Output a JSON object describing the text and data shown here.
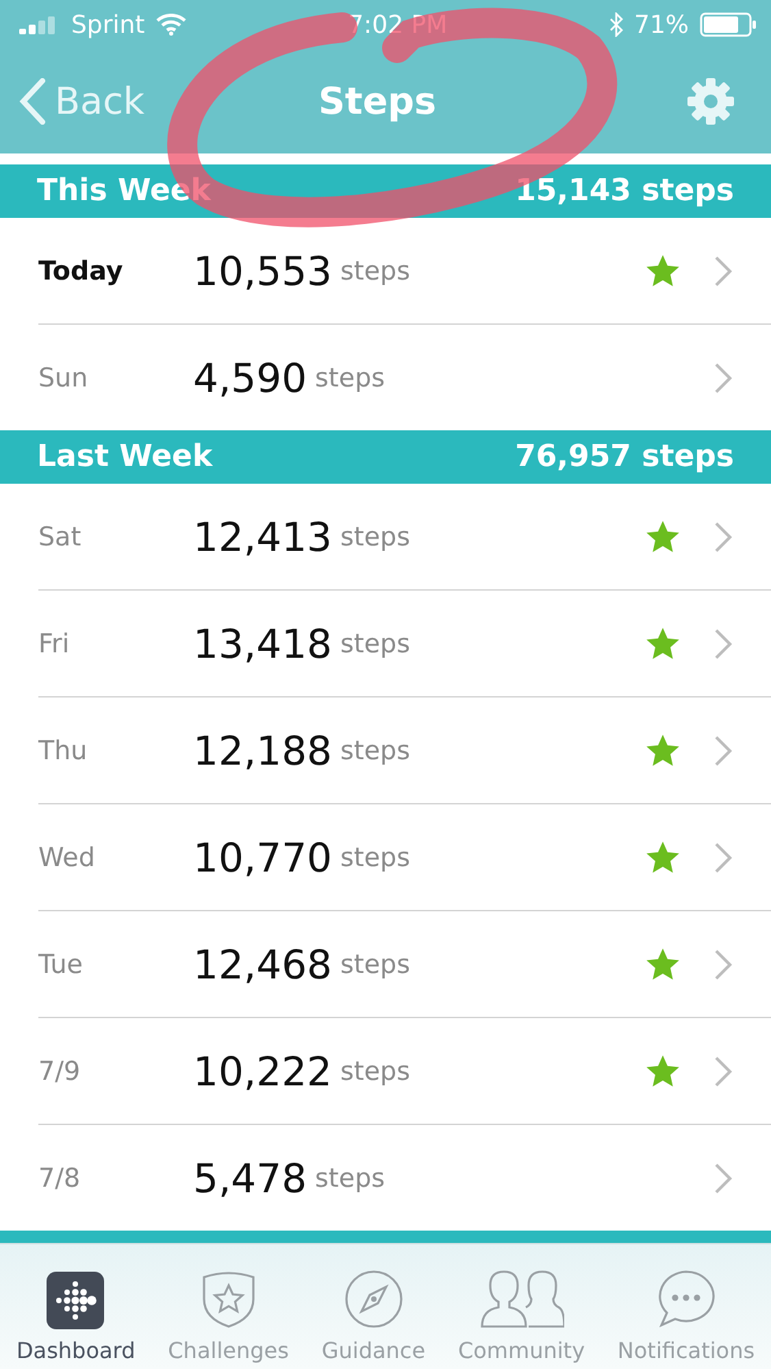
{
  "status_bar": {
    "carrier": "Sprint",
    "time": "7:02 PM",
    "battery": "71%"
  },
  "nav": {
    "back": "Back",
    "title": "Steps"
  },
  "sections": [
    {
      "label": "This Week",
      "total": "15,143 steps",
      "days": [
        {
          "day": "Today",
          "kind": "today",
          "count": "10,553",
          "unit": "steps",
          "goal_met": true
        },
        {
          "day": "Sun",
          "kind": "day",
          "count": "4,590",
          "unit": "steps",
          "goal_met": false
        }
      ]
    },
    {
      "label": "Last Week",
      "total": "76,957 steps",
      "days": [
        {
          "day": "Sat",
          "kind": "day",
          "count": "12,413",
          "unit": "steps",
          "goal_met": true
        },
        {
          "day": "Fri",
          "kind": "day",
          "count": "13,418",
          "unit": "steps",
          "goal_met": true
        },
        {
          "day": "Thu",
          "kind": "day",
          "count": "12,188",
          "unit": "steps",
          "goal_met": true
        },
        {
          "day": "Wed",
          "kind": "day",
          "count": "10,770",
          "unit": "steps",
          "goal_met": true
        },
        {
          "day": "Tue",
          "kind": "day",
          "count": "12,468",
          "unit": "steps",
          "goal_met": true
        },
        {
          "day": "7/9",
          "kind": "day",
          "count": "10,222",
          "unit": "steps",
          "goal_met": true
        },
        {
          "day": "7/8",
          "kind": "day",
          "count": "5,478",
          "unit": "steps",
          "goal_met": false
        }
      ]
    }
  ],
  "tab_bar": [
    {
      "label": "Dashboard",
      "kind": "dashboard",
      "selected": true
    },
    {
      "label": "Challenges",
      "kind": "challenges",
      "selected": false
    },
    {
      "label": "Guidance",
      "kind": "guidance",
      "selected": false
    },
    {
      "label": "Community",
      "kind": "community",
      "selected": false
    },
    {
      "label": "Notifications",
      "kind": "notifications",
      "selected": false
    }
  ]
}
